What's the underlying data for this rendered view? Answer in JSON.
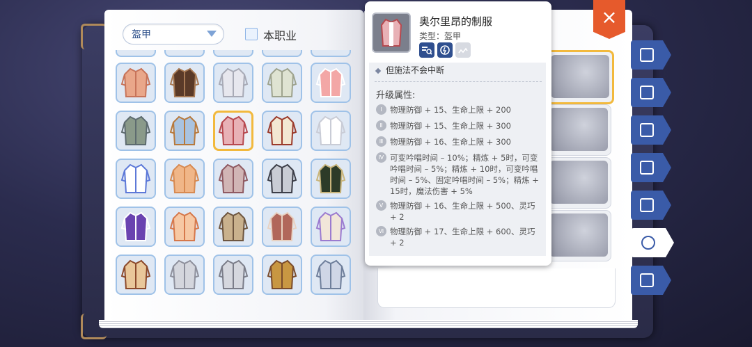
{
  "filter": {
    "dropdown_label": "盔甲",
    "checkbox_label": "本职业"
  },
  "grid": {
    "selected_index": 7,
    "items": [
      {
        "name": "armor-slot",
        "colors": [
          "#e9a78a",
          "#c7745a"
        ]
      },
      {
        "name": "armor-slot",
        "colors": [
          "#5a3a28",
          "#a77a55"
        ]
      },
      {
        "name": "armor-slot",
        "colors": [
          "#e7e7ee",
          "#a8aab6"
        ]
      },
      {
        "name": "armor-slot",
        "colors": [
          "#dfe3d2",
          "#9ea38e"
        ]
      },
      {
        "name": "armor-slot",
        "colors": [
          "#f3a7a6",
          "#ffffff"
        ]
      },
      {
        "name": "armor-slot",
        "colors": [
          "#8a9a8a",
          "#5d6b6f"
        ]
      },
      {
        "name": "armor-slot",
        "colors": [
          "#a9c3e0",
          "#b7793c"
        ]
      },
      {
        "name": "armor-slot",
        "colors": [
          "#e8b1b6",
          "#b7494f"
        ]
      },
      {
        "name": "armor-slot",
        "colors": [
          "#f3e7d2",
          "#9b3a2b"
        ]
      },
      {
        "name": "armor-slot",
        "colors": [
          "#ffffff",
          "#c9ccd6"
        ]
      },
      {
        "name": "armor-slot",
        "colors": [
          "#ffffff",
          "#5d79d8"
        ]
      },
      {
        "name": "armor-slot",
        "colors": [
          "#f0b688",
          "#d78a52"
        ]
      },
      {
        "name": "armor-slot",
        "colors": [
          "#d1b5b5",
          "#8f5a62"
        ]
      },
      {
        "name": "armor-slot",
        "colors": [
          "#c9ccd4",
          "#3c3e48"
        ]
      },
      {
        "name": "armor-slot",
        "colors": [
          "#2d3b28",
          "#c9b57c"
        ]
      },
      {
        "name": "armor-slot",
        "colors": [
          "#6a43b0",
          "#ffffff"
        ]
      },
      {
        "name": "armor-slot",
        "colors": [
          "#f6c8a4",
          "#d6784b"
        ]
      },
      {
        "name": "armor-slot",
        "colors": [
          "#c9b18d",
          "#6e5640"
        ]
      },
      {
        "name": "armor-slot",
        "colors": [
          "#b1675a",
          "#e8d2c2"
        ]
      },
      {
        "name": "armor-slot",
        "colors": [
          "#f1e6d9",
          "#9b7bd0"
        ]
      },
      {
        "name": "armor-slot",
        "colors": [
          "#e9c79a",
          "#8c4a2c"
        ]
      },
      {
        "name": "armor-slot",
        "colors": [
          "#d4d6dd",
          "#8e909c"
        ]
      },
      {
        "name": "armor-slot",
        "colors": [
          "#d5d7de",
          "#7b7d89"
        ]
      },
      {
        "name": "armor-slot",
        "colors": [
          "#c89742",
          "#7a4c2c"
        ]
      },
      {
        "name": "armor-slot",
        "colors": [
          "#cfd6e6",
          "#6f7f9b"
        ]
      }
    ]
  },
  "tooltip": {
    "title": "奥尔里昂的制服",
    "type": "类型：盔甲",
    "note": "但施法不会中断",
    "upgrade_header": "升级属性:",
    "levels": [
      {
        "roman": "Ⅰ",
        "text": "物理防御 + 15、生命上限 + 200"
      },
      {
        "roman": "Ⅱ",
        "text": "物理防御 + 15、生命上限 + 300"
      },
      {
        "roman": "Ⅲ",
        "text": "物理防御 + 16、生命上限 + 300"
      },
      {
        "roman": "Ⅳ",
        "text": "可变吟唱时间 – 10%；精炼 + 5时，可变吟唱时间 – 5%；精炼 + 10时，可变吟唱时间 – 5%、固定吟唱时间 – 5%；精炼 + 15时，魔法伤害 + 5%"
      },
      {
        "roman": "Ⅴ",
        "text": "物理防御 + 16、生命上限 + 500、灵巧 + 2"
      },
      {
        "roman": "Ⅵ",
        "text": "物理防御 + 17、生命上限 + 600、灵巧 + 2"
      }
    ]
  },
  "side_tabs": [
    {
      "name": "tab-book",
      "icon": "book-icon"
    },
    {
      "name": "tab-card",
      "icon": "card-icon"
    },
    {
      "name": "tab-headwear",
      "icon": "headwear-icon"
    },
    {
      "name": "tab-throne",
      "icon": "throne-icon"
    },
    {
      "name": "tab-mount",
      "icon": "rocking-horse-icon"
    },
    {
      "name": "tab-achievement",
      "icon": "badge-swirl-icon",
      "active": true
    },
    {
      "name": "tab-medal",
      "icon": "medal-icon"
    }
  ],
  "close_label": "×",
  "colors": {
    "accent": "#3a5ba8",
    "selected": "#f2b93d",
    "close": "#e65a2c"
  }
}
